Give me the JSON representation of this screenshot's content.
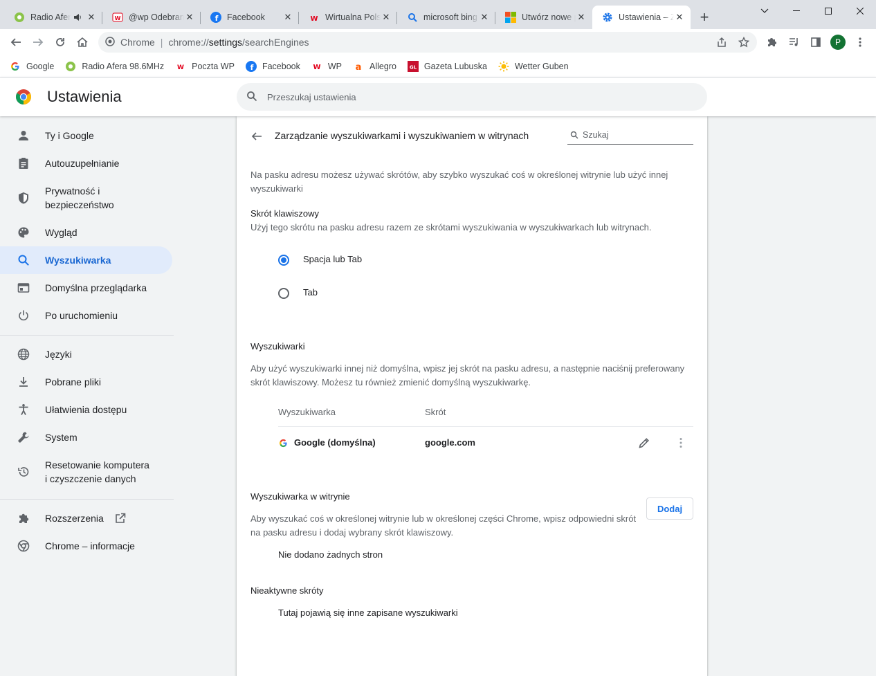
{
  "colors": {
    "accent": "#1a73e8",
    "selected_bg": "#e1ebfb",
    "tabstrip": "#dee1e6"
  },
  "tabs": [
    {
      "title": "Radio Afera",
      "icon": "radio-afera-icon",
      "extra": "speaker-icon"
    },
    {
      "title": "@wp Odebrane",
      "icon": "wp-mail-icon"
    },
    {
      "title": "Facebook",
      "icon": "facebook-icon"
    },
    {
      "title": "Wirtualna Polska",
      "icon": "wp-icon"
    },
    {
      "title": "microsoft bing",
      "icon": "search-icon"
    },
    {
      "title": "Utwórz nowe p",
      "icon": "microsoft-icon"
    },
    {
      "title": "Ustawienia – Z",
      "icon": "settings-gear-icon",
      "active": true
    }
  ],
  "omnibox": {
    "site_label": "Chrome",
    "url_scheme": "chrome://",
    "url_host": "settings",
    "url_path": "/searchEngines"
  },
  "profile": {
    "initial": "P"
  },
  "bookmarks": [
    {
      "label": "Google",
      "icon": "google-icon"
    },
    {
      "label": "Radio Afera 98.6MHz",
      "icon": "radio-afera-icon"
    },
    {
      "label": "Poczta WP",
      "icon": "wp-mail-icon"
    },
    {
      "label": "Facebook",
      "icon": "facebook-icon"
    },
    {
      "label": "WP",
      "icon": "wp-icon"
    },
    {
      "label": "Allegro",
      "icon": "allegro-icon"
    },
    {
      "label": "Gazeta Lubuska",
      "icon": "gazeta-lubuska-icon"
    },
    {
      "label": "Wetter Guben",
      "icon": "sun-icon"
    }
  ],
  "header": {
    "title": "Ustawienia",
    "search_placeholder": "Przeszukaj ustawienia"
  },
  "sidebar": {
    "items": [
      {
        "label": "Ty i Google",
        "icon": "person-icon"
      },
      {
        "label": "Autouzupełnianie",
        "icon": "clipboard-icon"
      },
      {
        "label_line1": "Prywatność i",
        "label_line2": "bezpieczeństwo",
        "icon": "shield-icon"
      },
      {
        "label": "Wygląd",
        "icon": "palette-icon"
      },
      {
        "label": "Wyszukiwarka",
        "icon": "search-icon",
        "selected": true
      },
      {
        "label": "Domyślna przeglądarka",
        "icon": "browser-icon"
      },
      {
        "label": "Po uruchomieniu",
        "icon": "power-icon"
      },
      {
        "label": "Języki",
        "icon": "globe-icon"
      },
      {
        "label": "Pobrane pliki",
        "icon": "download-icon"
      },
      {
        "label": "Ułatwienia dostępu",
        "icon": "accessibility-icon"
      },
      {
        "label": "System",
        "icon": "wrench-icon"
      },
      {
        "label_line1": "Resetowanie komputera",
        "label_line2": "i czyszczenie danych",
        "icon": "history-icon"
      },
      {
        "label": "Rozszerzenia",
        "icon": "puzzle-icon"
      },
      {
        "label": "Chrome – informacje",
        "icon": "chrome-icon"
      }
    ]
  },
  "page": {
    "title": "Zarządzanie wyszukiwarkami i wyszukiwaniem w witrynach",
    "filter_placeholder": "Szukaj",
    "intro_line1": "Na pasku adresu możesz używać skrótów, aby szybko wyszukać coś w określonej witrynie lub użyć innej",
    "intro_line2": "wyszukiwarki",
    "shortcut_title": "Skrót klawiszowy",
    "shortcut_desc": "Użyj tego skrótu na pasku adresu razem ze skrótami wyszukiwania w wyszukiwarkach lub witrynach.",
    "radio_space_tab": "Spacja lub Tab",
    "radio_tab": "Tab",
    "engines_title": "Wyszukiwarki",
    "engines_desc_line1": "Aby użyć wyszukiwarki innej niż domyślna, wpisz jej skrót na pasku adresu, a następnie naciśnij preferowany",
    "engines_desc_line2": "skrót klawiszowy. Możesz tu również zmienić domyślną wyszukiwarkę.",
    "col_engine": "Wyszukiwarka",
    "col_shortcut": "Skrót",
    "engine_name": "Google (domyślna)",
    "engine_shortcut": "google.com",
    "site_search_title": "Wyszukiwarka w witrynie",
    "site_search_desc_line1": "Aby wyszukać coś w określonej witrynie lub w określonej części Chrome, wpisz odpowiedni skrót",
    "site_search_desc_line2": "na pasku adresu i dodaj wybrany skrót klawiszowy.",
    "add_button": "Dodaj",
    "no_sites": "Nie dodano żadnych stron",
    "inactive_title": "Nieaktywne skróty",
    "inactive_desc": "Tutaj pojawią się inne zapisane wyszukiwarki"
  }
}
